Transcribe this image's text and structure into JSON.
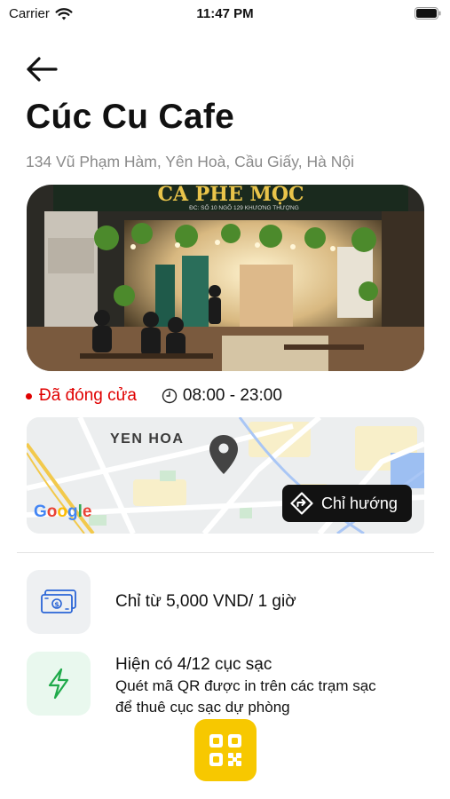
{
  "status_bar": {
    "carrier": "Carrier",
    "time": "11:47 PM"
  },
  "place": {
    "name": "Cúc Cu Cafe",
    "address": "134 Vũ Phạm Hàm, Yên Hoà, Cầu Giấy, Hà Nội",
    "sign_text": "CÀ PHÊ MỘC",
    "sign_subtext": "ĐC: SỐ 10 NGÕ 129 KHƯƠNG THƯỢNG"
  },
  "hours": {
    "status": "Đã đóng cửa",
    "range": "08:00 - 23:00"
  },
  "map": {
    "area_label": "YEN HOA",
    "google_letters": [
      "G",
      "o",
      "o",
      "g",
      "l",
      "e"
    ],
    "google_colors": [
      "#4285F4",
      "#EA4335",
      "#FBBC05",
      "#4285F4",
      "#34A853",
      "#EA4335"
    ],
    "directions_label": "Chỉ hướng"
  },
  "price": {
    "text": "Chỉ từ 5,000 VND/ 1 giờ"
  },
  "chargers": {
    "title": "Hiện có 4/12 cục sạc",
    "description_line1": "Quét mã QR được in trên các trạm sạc",
    "description_line2": "để thuê cục sạc dự phòng"
  },
  "icons": {
    "back": "arrow-left-icon",
    "clock": "clock-icon",
    "pin": "map-pin-icon",
    "directions": "directions-icon",
    "money": "money-icon",
    "bolt": "bolt-icon",
    "qr": "qr-code-icon"
  },
  "colors": {
    "closed": "#e00000",
    "qr_accent": "#f7c800",
    "bolt": "#1faa4a",
    "money": "#2a65d6"
  }
}
